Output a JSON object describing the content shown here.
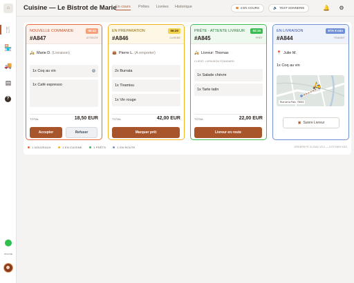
{
  "app": {
    "logo_text": "⌂",
    "title": "Cuisine — Le Bistrot de Marie"
  },
  "tabs": [
    {
      "label": "En cours",
      "active": true
    },
    {
      "label": "Prêtes",
      "active": false
    },
    {
      "label": "Livrées",
      "active": false
    },
    {
      "label": "Historique",
      "active": false
    }
  ],
  "header": {
    "in_progress_badge": "4 EN COURS",
    "test_bell_label": "TEST SONNERIE",
    "bell_icon": "bell-icon",
    "settings_icon": "gear-icon"
  },
  "sidebar": {
    "items": [
      {
        "name": "orders",
        "icon": "utensils-icon",
        "glyph": "🍴",
        "active": true
      },
      {
        "name": "store",
        "icon": "store-icon",
        "glyph": "🏪",
        "active": false
      },
      {
        "name": "delivery",
        "icon": "truck-icon",
        "glyph": "🚚",
        "active": false
      },
      {
        "name": "inventory",
        "icon": "box-icon",
        "glyph": "▤",
        "active": false
      },
      {
        "name": "help",
        "icon": "help-icon",
        "glyph": "?",
        "active": false
      }
    ],
    "status_label": "ONLINE"
  },
  "colors": {
    "new": "#e8673a",
    "prep": "#f3b322",
    "ready": "#3dbb53",
    "delivery": "#6f8fd6",
    "accent": "#a9552b"
  },
  "orders": [
    {
      "status": "NOUVELLE COMMANDE",
      "number": "#A847",
      "badge": "00:41",
      "badge_sub": "ATTENTE",
      "customer": "Marie D.",
      "customer_note": "(Livraison)",
      "customer_icon": "scooter-icon",
      "items": [
        "1x Coq au vin",
        "1x Café espresso"
      ],
      "total_label": "TOTAL",
      "total": "18,50 EUR",
      "actions": [
        "Accepter",
        "Refuser"
      ]
    },
    {
      "status": "EN PREPARATION",
      "number": "#A846",
      "badge": "06:20",
      "badge_sub": "CUISINE",
      "customer": "Pierre L.",
      "customer_note": "(A emporter)",
      "customer_icon": "bag-icon",
      "items": [
        "2x Burrata",
        "1x Tiramisu",
        "1x Vin rouge"
      ],
      "total_label": "TOTAL",
      "total": "42,00 EUR",
      "actions": [
        "Marquer prêt"
      ]
    },
    {
      "status": "PRÊTE · ATTENTE LIVREUR",
      "number": "#A845",
      "badge": "02:15",
      "badge_sub": "PRÊT",
      "customer": "Livreur: Thomas",
      "customer_note": "",
      "customer_icon": "scooter-icon",
      "sub_line": "CLIENT: LIVRAISON STANDARD",
      "items": [
        "1x Salade chèvre",
        "1x Tarte tatin"
      ],
      "total_label": "TOTAL",
      "total": "22,00 EUR",
      "actions": [
        "Livreur en route"
      ]
    },
    {
      "status": "EN LIVRAISON",
      "number": "#A844",
      "badge": "ETA 8 min",
      "badge_sub": "TRANSIT",
      "customer": "Julie M.",
      "customer_note": "",
      "customer_icon": "pin-icon",
      "items": [
        "1x Coq au vin"
      ],
      "map_address": "Rue de la Paix, 75002",
      "actions": [
        "Suivre Livreur"
      ]
    }
  ],
  "legend": [
    {
      "label": "1 NOUVEAUX",
      "color": "#e8673a"
    },
    {
      "label": "1 EN CUISINE",
      "color": "#f3b322"
    },
    {
      "label": "1 PRÊTS",
      "color": "#3dbb53"
    },
    {
      "label": "1 EN ROUTE",
      "color": "#6f8fd6"
    }
  ],
  "footer_right": "ORDERSYS CLOUD V3.2 — KITCHEN KDS"
}
